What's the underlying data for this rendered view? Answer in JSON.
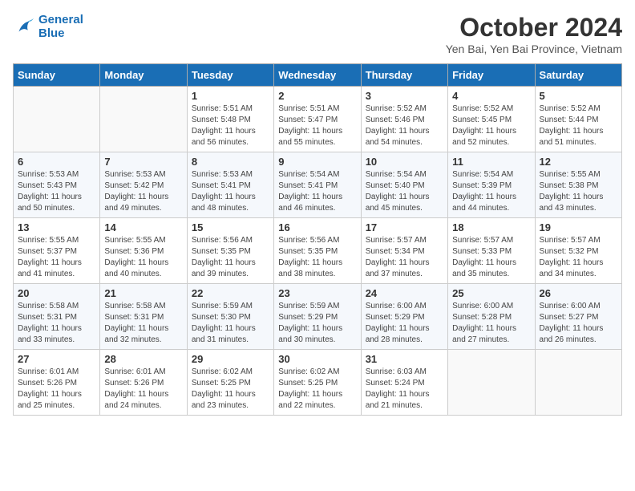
{
  "header": {
    "logo_line1": "General",
    "logo_line2": "Blue",
    "month_title": "October 2024",
    "subtitle": "Yen Bai, Yen Bai Province, Vietnam"
  },
  "days_of_week": [
    "Sunday",
    "Monday",
    "Tuesday",
    "Wednesday",
    "Thursday",
    "Friday",
    "Saturday"
  ],
  "weeks": [
    [
      {
        "day": "",
        "text": ""
      },
      {
        "day": "",
        "text": ""
      },
      {
        "day": "1",
        "text": "Sunrise: 5:51 AM\nSunset: 5:48 PM\nDaylight: 11 hours and 56 minutes."
      },
      {
        "day": "2",
        "text": "Sunrise: 5:51 AM\nSunset: 5:47 PM\nDaylight: 11 hours and 55 minutes."
      },
      {
        "day": "3",
        "text": "Sunrise: 5:52 AM\nSunset: 5:46 PM\nDaylight: 11 hours and 54 minutes."
      },
      {
        "day": "4",
        "text": "Sunrise: 5:52 AM\nSunset: 5:45 PM\nDaylight: 11 hours and 52 minutes."
      },
      {
        "day": "5",
        "text": "Sunrise: 5:52 AM\nSunset: 5:44 PM\nDaylight: 11 hours and 51 minutes."
      }
    ],
    [
      {
        "day": "6",
        "text": "Sunrise: 5:53 AM\nSunset: 5:43 PM\nDaylight: 11 hours and 50 minutes."
      },
      {
        "day": "7",
        "text": "Sunrise: 5:53 AM\nSunset: 5:42 PM\nDaylight: 11 hours and 49 minutes."
      },
      {
        "day": "8",
        "text": "Sunrise: 5:53 AM\nSunset: 5:41 PM\nDaylight: 11 hours and 48 minutes."
      },
      {
        "day": "9",
        "text": "Sunrise: 5:54 AM\nSunset: 5:41 PM\nDaylight: 11 hours and 46 minutes."
      },
      {
        "day": "10",
        "text": "Sunrise: 5:54 AM\nSunset: 5:40 PM\nDaylight: 11 hours and 45 minutes."
      },
      {
        "day": "11",
        "text": "Sunrise: 5:54 AM\nSunset: 5:39 PM\nDaylight: 11 hours and 44 minutes."
      },
      {
        "day": "12",
        "text": "Sunrise: 5:55 AM\nSunset: 5:38 PM\nDaylight: 11 hours and 43 minutes."
      }
    ],
    [
      {
        "day": "13",
        "text": "Sunrise: 5:55 AM\nSunset: 5:37 PM\nDaylight: 11 hours and 41 minutes."
      },
      {
        "day": "14",
        "text": "Sunrise: 5:55 AM\nSunset: 5:36 PM\nDaylight: 11 hours and 40 minutes."
      },
      {
        "day": "15",
        "text": "Sunrise: 5:56 AM\nSunset: 5:35 PM\nDaylight: 11 hours and 39 minutes."
      },
      {
        "day": "16",
        "text": "Sunrise: 5:56 AM\nSunset: 5:35 PM\nDaylight: 11 hours and 38 minutes."
      },
      {
        "day": "17",
        "text": "Sunrise: 5:57 AM\nSunset: 5:34 PM\nDaylight: 11 hours and 37 minutes."
      },
      {
        "day": "18",
        "text": "Sunrise: 5:57 AM\nSunset: 5:33 PM\nDaylight: 11 hours and 35 minutes."
      },
      {
        "day": "19",
        "text": "Sunrise: 5:57 AM\nSunset: 5:32 PM\nDaylight: 11 hours and 34 minutes."
      }
    ],
    [
      {
        "day": "20",
        "text": "Sunrise: 5:58 AM\nSunset: 5:31 PM\nDaylight: 11 hours and 33 minutes."
      },
      {
        "day": "21",
        "text": "Sunrise: 5:58 AM\nSunset: 5:31 PM\nDaylight: 11 hours and 32 minutes."
      },
      {
        "day": "22",
        "text": "Sunrise: 5:59 AM\nSunset: 5:30 PM\nDaylight: 11 hours and 31 minutes."
      },
      {
        "day": "23",
        "text": "Sunrise: 5:59 AM\nSunset: 5:29 PM\nDaylight: 11 hours and 30 minutes."
      },
      {
        "day": "24",
        "text": "Sunrise: 6:00 AM\nSunset: 5:29 PM\nDaylight: 11 hours and 28 minutes."
      },
      {
        "day": "25",
        "text": "Sunrise: 6:00 AM\nSunset: 5:28 PM\nDaylight: 11 hours and 27 minutes."
      },
      {
        "day": "26",
        "text": "Sunrise: 6:00 AM\nSunset: 5:27 PM\nDaylight: 11 hours and 26 minutes."
      }
    ],
    [
      {
        "day": "27",
        "text": "Sunrise: 6:01 AM\nSunset: 5:26 PM\nDaylight: 11 hours and 25 minutes."
      },
      {
        "day": "28",
        "text": "Sunrise: 6:01 AM\nSunset: 5:26 PM\nDaylight: 11 hours and 24 minutes."
      },
      {
        "day": "29",
        "text": "Sunrise: 6:02 AM\nSunset: 5:25 PM\nDaylight: 11 hours and 23 minutes."
      },
      {
        "day": "30",
        "text": "Sunrise: 6:02 AM\nSunset: 5:25 PM\nDaylight: 11 hours and 22 minutes."
      },
      {
        "day": "31",
        "text": "Sunrise: 6:03 AM\nSunset: 5:24 PM\nDaylight: 11 hours and 21 minutes."
      },
      {
        "day": "",
        "text": ""
      },
      {
        "day": "",
        "text": ""
      }
    ]
  ]
}
